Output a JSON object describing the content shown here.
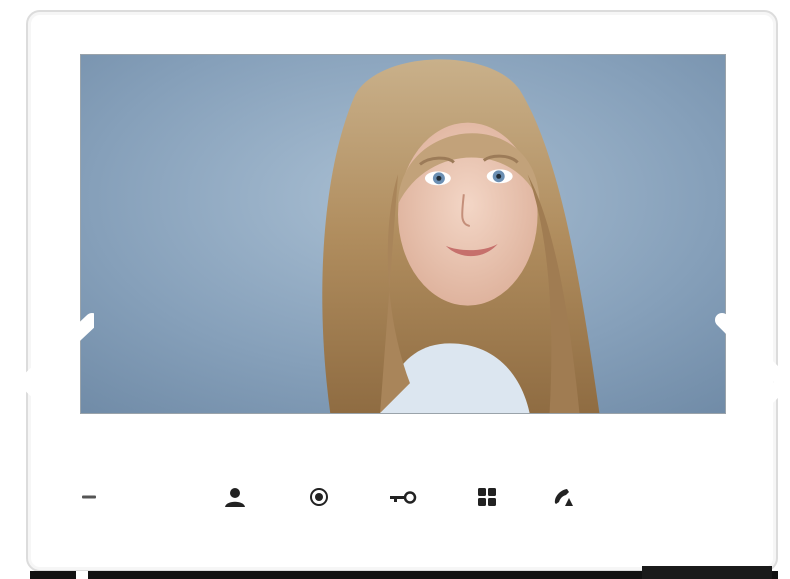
{
  "device": {
    "frame_color": "#ffffff",
    "screen_background": "#7d98b2"
  },
  "screen": {
    "content": "video-feed-portrait"
  },
  "buttons": [
    {
      "name": "standby-indicator",
      "icon": "dash-icon"
    },
    {
      "name": "user-button",
      "icon": "user-icon"
    },
    {
      "name": "monitor-button",
      "icon": "record-circle-icon"
    },
    {
      "name": "unlock-button",
      "icon": "key-icon"
    },
    {
      "name": "menu-button",
      "icon": "grid-icon"
    },
    {
      "name": "call-button",
      "icon": "handset-icon"
    }
  ],
  "navigation": {
    "prev_icon": "chevron-left-icon",
    "next_icon": "chevron-right-icon"
  }
}
